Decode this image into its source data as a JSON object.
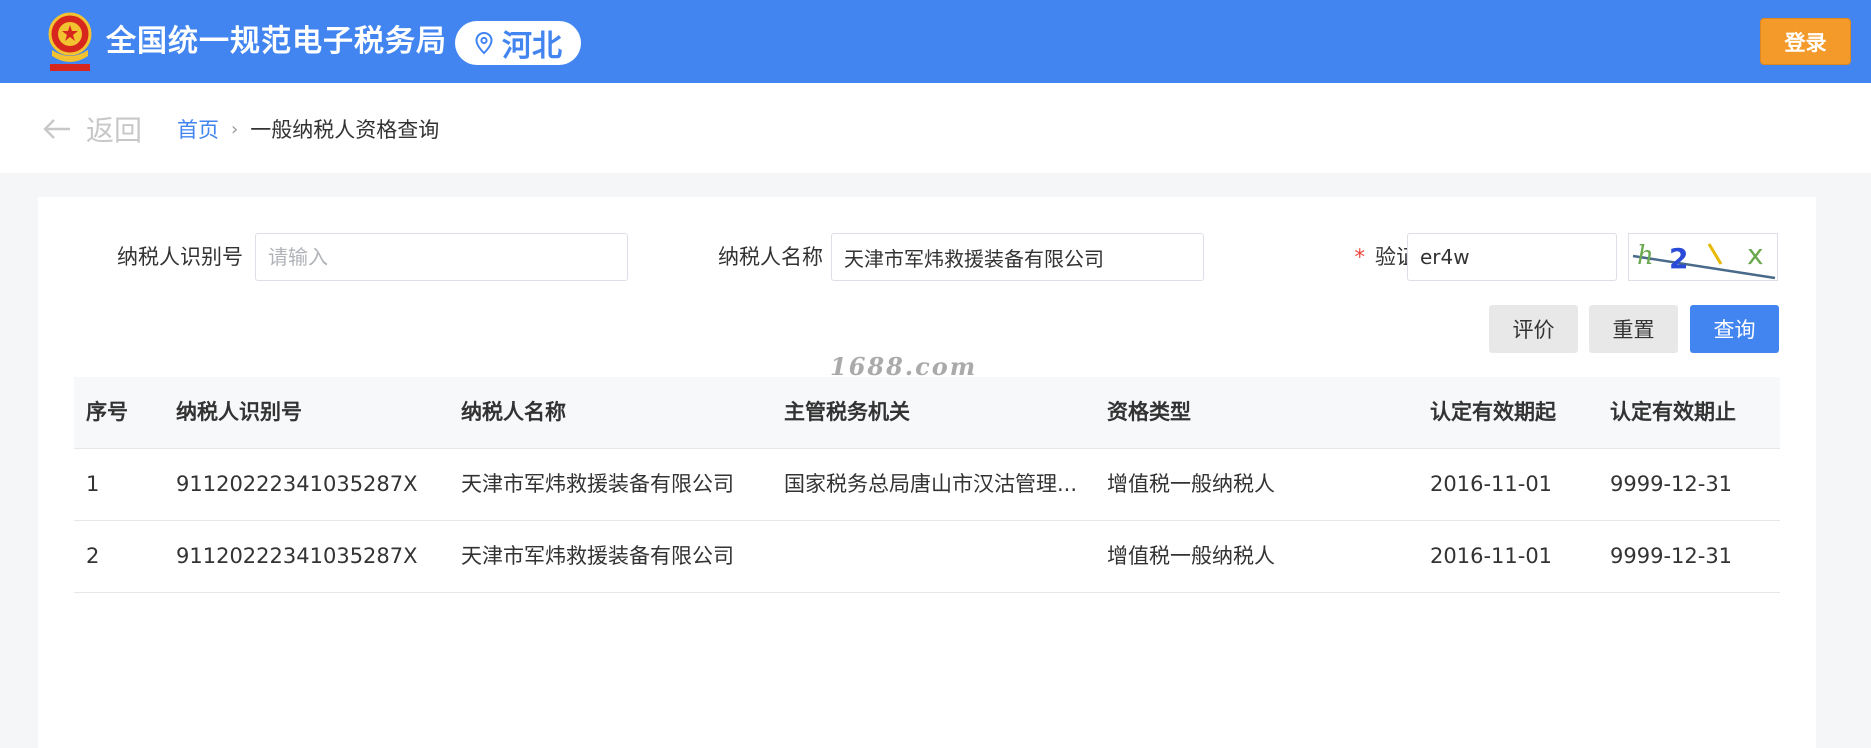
{
  "header": {
    "title": "全国统一规范电子税务局",
    "region": "河北",
    "login_label": "登录"
  },
  "breadcrumb": {
    "back_label": "返回",
    "home": "首页",
    "current": "一般纳税人资格查询"
  },
  "form": {
    "taxpayer_id_label": "纳税人识别号",
    "taxpayer_id_value": "",
    "taxpayer_id_placeholder": "请输入",
    "taxpayer_name_label": "纳税人名称",
    "taxpayer_name_value": "天津市军炜救援装备有限公司",
    "captcha_required_mark": "*",
    "captcha_label": "验证码",
    "captcha_value": "er4w",
    "captcha_image_text": "h2\\x"
  },
  "buttons": {
    "evaluate": "评价",
    "reset": "重置",
    "query": "查询"
  },
  "table": {
    "columns": [
      "序号",
      "纳税人识别号",
      "纳税人名称",
      "主管税务机关",
      "资格类型",
      "认定有效期起",
      "认定有效期止"
    ],
    "rows": [
      [
        "1",
        "91120222341035287X",
        "天津市军炜救援装备有限公司",
        "国家税务总局唐山市汉沽管理...",
        "增值税一般纳税人",
        "2016-11-01",
        "9999-12-31"
      ],
      [
        "2",
        "91120222341035287X",
        "天津市军炜救援装备有限公司",
        "",
        "增值税一般纳税人",
        "2016-11-01",
        "9999-12-31"
      ]
    ]
  },
  "watermark": "1688.com",
  "colors": {
    "primary": "#4285f0",
    "login": "#f39a2b",
    "required": "#e8443a"
  }
}
